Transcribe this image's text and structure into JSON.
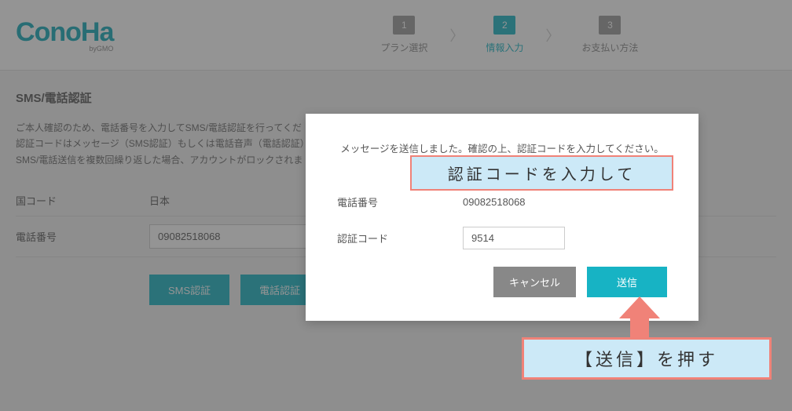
{
  "header": {
    "logo_text": "ConoHa",
    "logo_sub": "byGMO",
    "steps": [
      {
        "num": "1",
        "label": "プラン選択"
      },
      {
        "num": "2",
        "label": "情報入力"
      },
      {
        "num": "3",
        "label": "お支払い方法"
      }
    ],
    "active_step": 1
  },
  "page": {
    "title": "SMS/電話認証",
    "desc_line1": "ご本人確認のため、電話番号を入力してSMS/電話認証を行ってくだ",
    "desc_line2": "認証コードはメッセージ（SMS認証）もしくは電話音声（電話認証）",
    "desc_line3": "SMS/電話送信を複数回繰り返した場合、アカウントがロックされま",
    "country_label": "国コード",
    "country_value": "日本",
    "phone_label": "電話番号",
    "phone_value": "09082518068",
    "sms_btn": "SMS認証",
    "tel_btn": "電話認証"
  },
  "modal": {
    "msg": "メッセージを送信しました。確認の上、認証コードを入力してください。",
    "phone_label": "電話番号",
    "phone_value": "09082518068",
    "code_label": "認証コード",
    "code_value": "9514",
    "cancel": "キャンセル",
    "submit": "送信"
  },
  "annotations": {
    "callout1": "認証コードを入力して",
    "callout2": "【送信】を押す"
  }
}
